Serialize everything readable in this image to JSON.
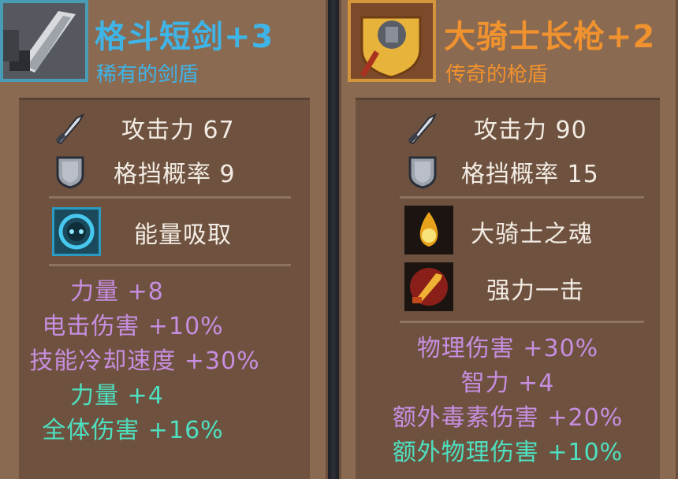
{
  "left_item": {
    "name": "格斗短剑+3",
    "subtitle": "稀有的剑盾",
    "rarity_color": "#3fb4e6",
    "stats": [
      {
        "icon": "sword-icon",
        "label": "攻击力 67"
      },
      {
        "icon": "shield-icon",
        "label": "格挡概率 9"
      }
    ],
    "ability": {
      "icon": "energy-drain-icon",
      "label": "能量吸取"
    },
    "bonuses": [
      {
        "text": "力量 +8",
        "color": "purple"
      },
      {
        "text": "电击伤害 +10%",
        "color": "purple"
      },
      {
        "text": "技能冷却速度 +30%",
        "color": "purple"
      },
      {
        "text": "力量 +4",
        "color": "teal"
      },
      {
        "text": "全体伤害 +16%",
        "color": "teal"
      }
    ]
  },
  "right_item": {
    "name": "大骑士长枪+2",
    "subtitle": "传奇的枪盾",
    "rarity_color": "#f0922e",
    "stats": [
      {
        "icon": "sword-icon",
        "label": "攻击力 90"
      },
      {
        "icon": "shield-icon",
        "label": "格挡概率 15"
      }
    ],
    "abilities": [
      {
        "icon": "flame-soul-icon",
        "label": "大骑士之魂"
      },
      {
        "icon": "power-strike-icon",
        "label": "强力一击"
      }
    ],
    "bonuses": [
      {
        "text": "物理伤害 +30%",
        "color": "purple"
      },
      {
        "text": "智力 +4",
        "color": "purple"
      },
      {
        "text": "额外毒素伤害 +20%",
        "color": "purple"
      },
      {
        "text": "额外物理伤害 +10%",
        "color": "teal"
      }
    ]
  }
}
